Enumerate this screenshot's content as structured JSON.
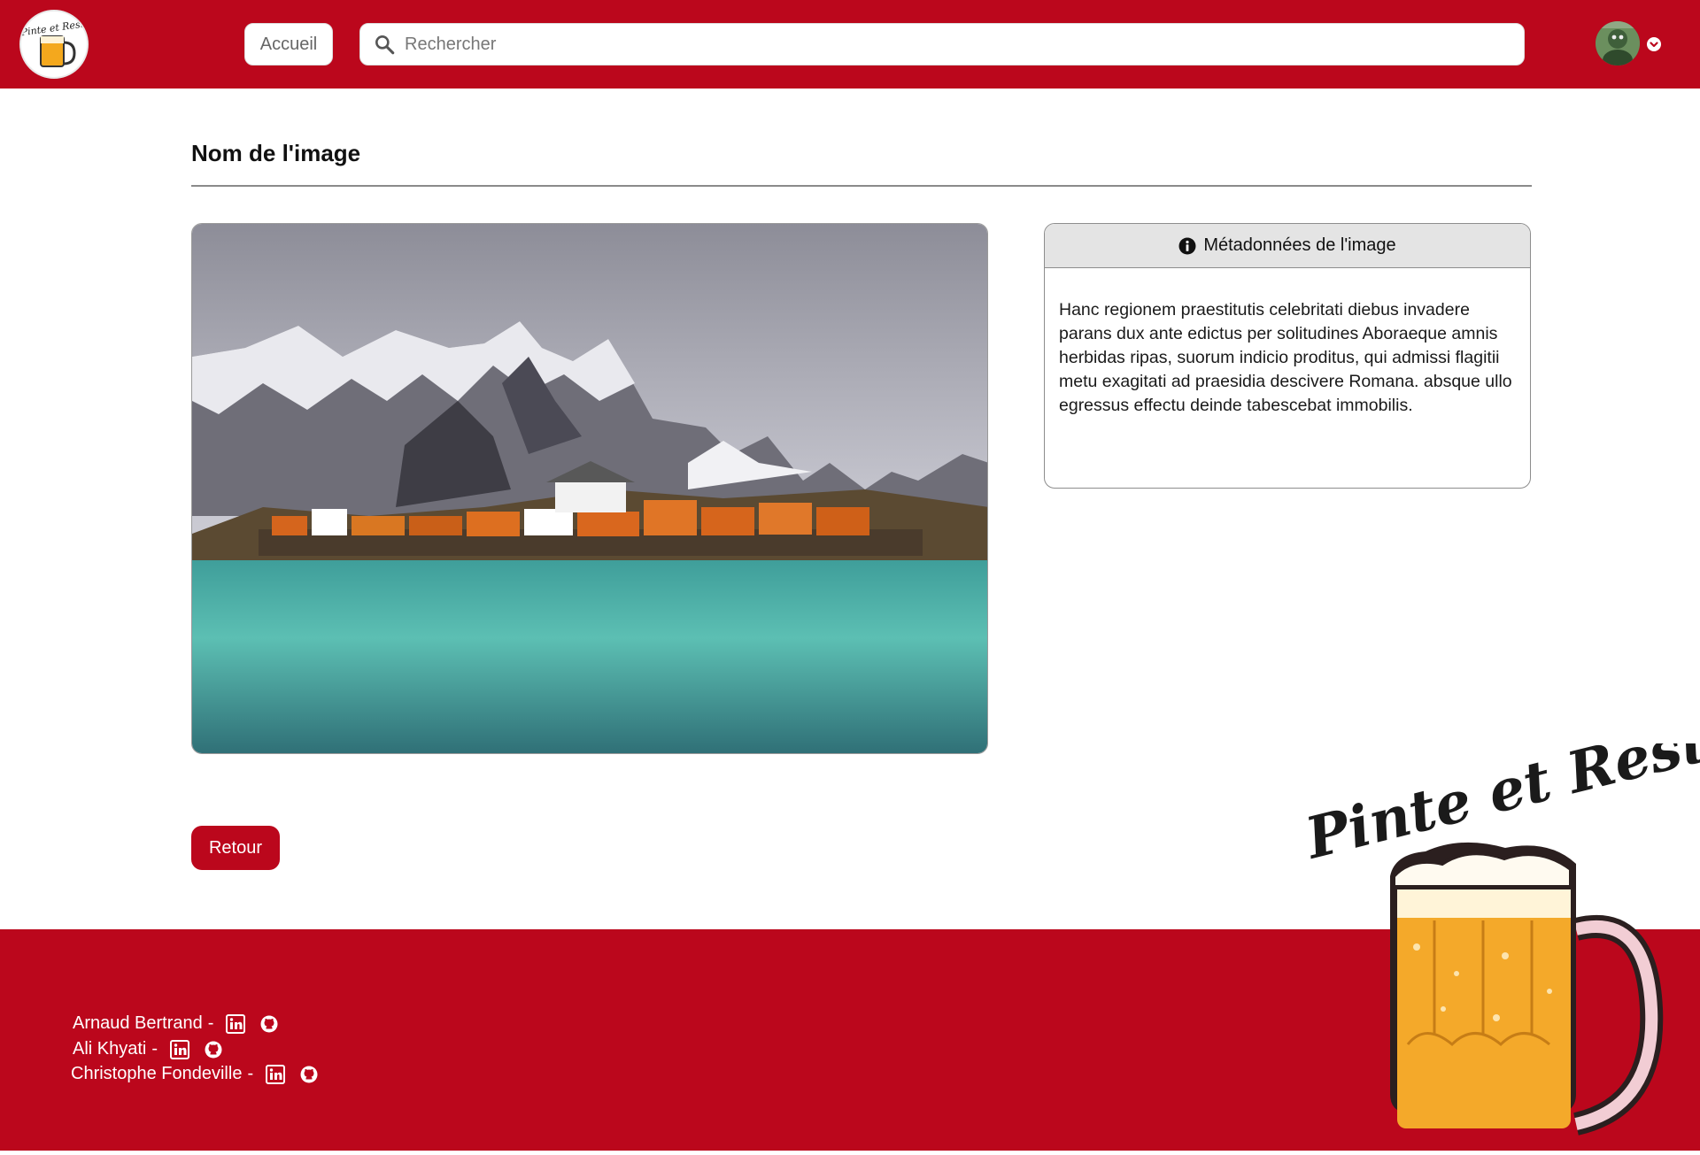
{
  "header": {
    "home_label": "Accueil",
    "search_placeholder": "Rechercher",
    "logo_text": "Pinte et Reste"
  },
  "main": {
    "title": "Nom de l'image",
    "metadata": {
      "heading": "Métadonnées de l'image",
      "text": "Hanc regionem praestitutis celebritati diebus invadere parans dux ante edictus per solitudines Aboraeque amnis herbidas ripas, suorum indicio proditus, qui admissi flagitii metu exagitati ad praesidia descivere Romana. absque ullo egressus effectu deinde tabescebat immobilis."
    },
    "back_label": "Retour"
  },
  "footer": {
    "credits": [
      {
        "name": "Arnaud Bertrand",
        "separator": "-"
      },
      {
        "name": "Ali Khyati",
        "separator": "-"
      },
      {
        "name": "Christophe Fondeville",
        "separator": "-"
      }
    ],
    "logo_text": "Pinte et Reste"
  },
  "colors": {
    "brand_red": "#bb071c",
    "card_header": "#e4e4e4"
  },
  "icons": [
    "search-icon",
    "chevron-down-icon",
    "info-icon",
    "linkedin-icon",
    "github-icon"
  ]
}
